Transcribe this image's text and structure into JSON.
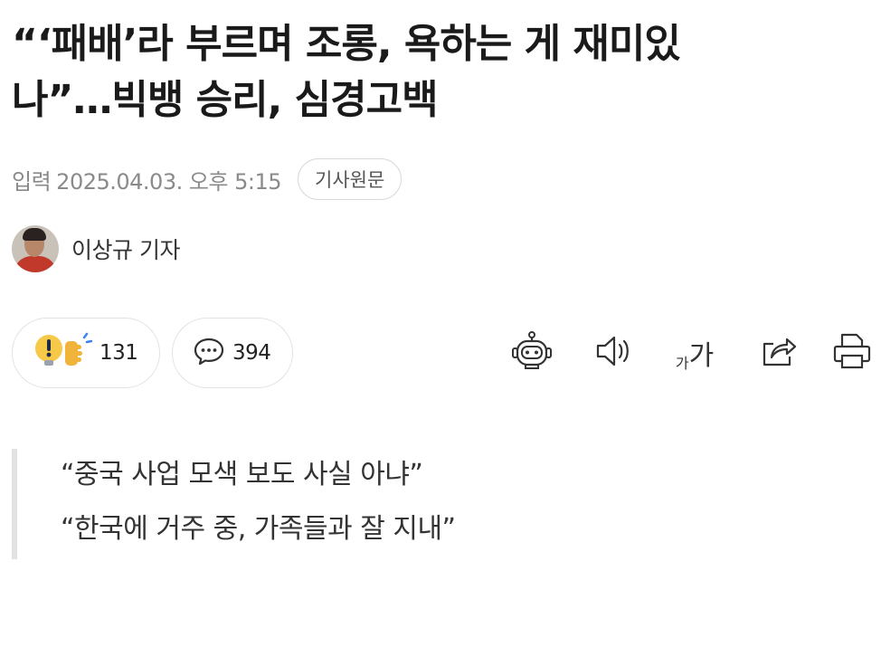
{
  "article": {
    "headline_line1": "“‘패배’라 부르며 조롱, 욕하는 게 재미있",
    "headline_line2": "나”…빅뱅 승리, 심경고백",
    "meta_label": "입력",
    "published": "2025.04.03. 오후 5:15",
    "origin_button": "기사원문",
    "reporter": "이상규 기자"
  },
  "actions": {
    "reaction_count": "131",
    "comment_count": "394",
    "font_small": "가",
    "font_large": "가"
  },
  "icons": {
    "reaction": "lightbulb-exclaim-icon",
    "comment": "speech-bubble-icon",
    "summary_bot": "robot-icon",
    "listen": "speaker-icon",
    "font_size": "font-size-icon",
    "share": "share-icon",
    "print": "printer-icon"
  },
  "subheads": [
    "“중국 사업 모색 보도 사실 아냐”",
    "“한국에 거주 중, 가족들과 잘 지내”"
  ],
  "colors": {
    "bulb_yellow": "#f7c948",
    "hand_yellow": "#f0b43a",
    "accent_blue": "#3b82f6"
  }
}
